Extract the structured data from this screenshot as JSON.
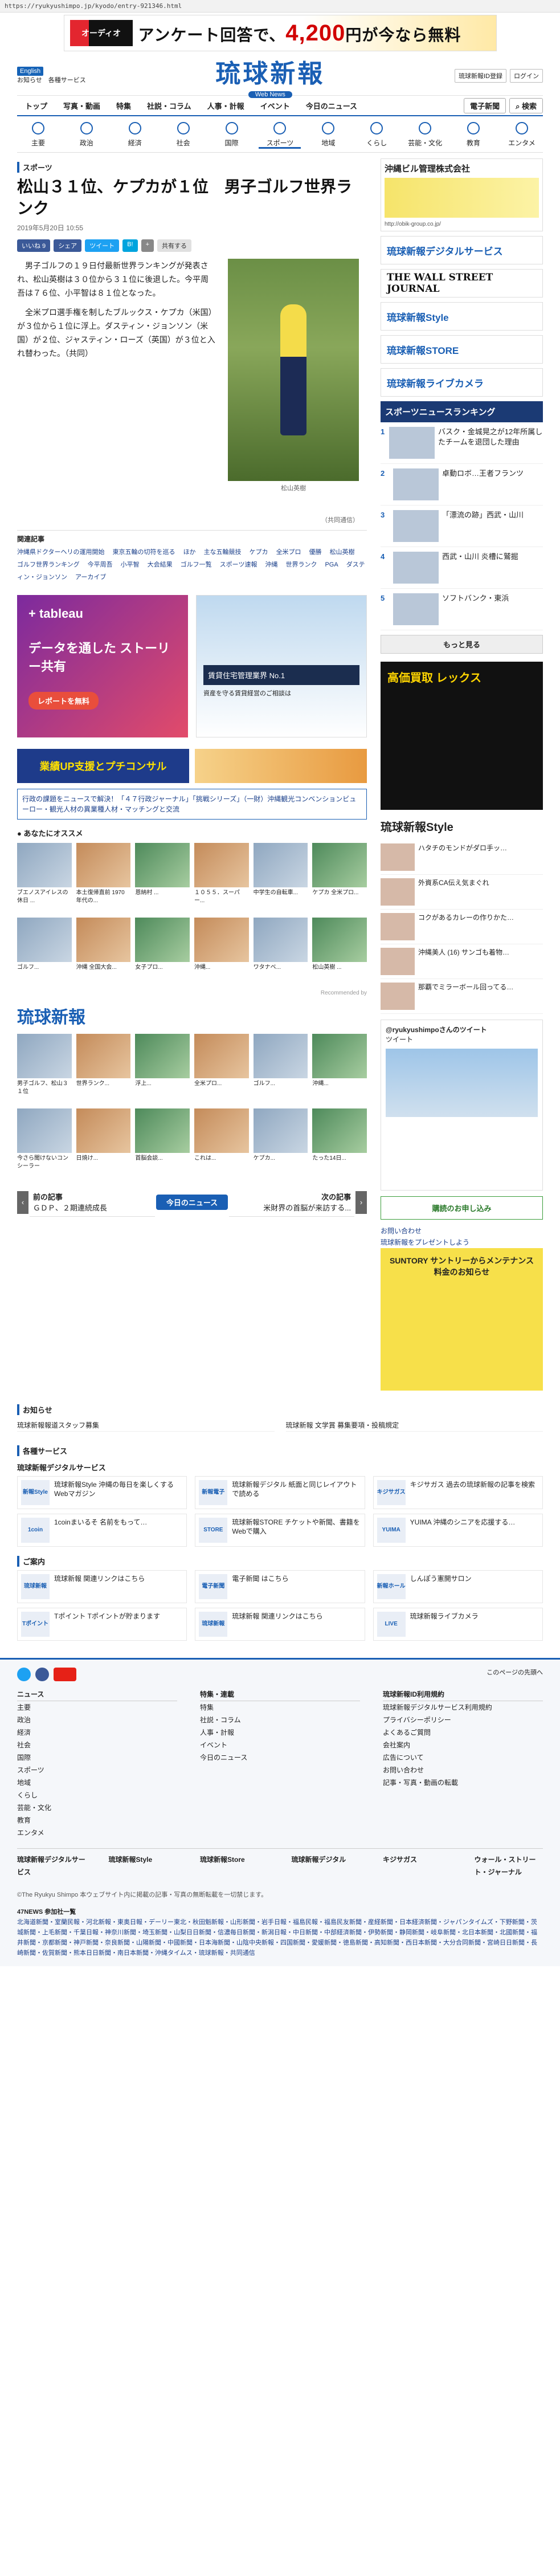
{
  "url": "https://ryukyushimpo.jp/kyodo/entry-921346.html",
  "banner": {
    "logo": "オーディオ",
    "t1": "アンケート回答で、",
    "price": "4,200",
    "t2": "円が今なら無料"
  },
  "header": {
    "en": "English",
    "info": "お知らせ",
    "svc": "各種サービス",
    "jp": "琉球新報",
    "sub": "Web News",
    "r1": "琉球新報ID登録",
    "r2": "ログイン"
  },
  "gnav": [
    "トップ",
    "写真・動画",
    "特集",
    "社説・コラム",
    "人事・計報",
    "イベント",
    "今日のニュース",
    "電子新聞",
    "検索"
  ],
  "cnav": [
    "主要",
    "政治",
    "経済",
    "社会",
    "国際",
    "スポーツ",
    "地域",
    "くらし",
    "芸能・文化",
    "教育",
    "エンタメ"
  ],
  "article": {
    "cat": "スポーツ",
    "title": "松山３１位、ケプカが１位　男子ゴルフ世界ランク",
    "date": "2019年5月20日 10:55",
    "share": [
      "いいね 9",
      "シェア",
      "ツイート",
      "B!",
      "+",
      "共有する"
    ],
    "p1": "　男子ゴルフの１９日付最新世界ランキングが発表され、松山英樹は３０位から３１位に後退した。今平周吾は７６位、小平智は８１位となった。",
    "p2": "　全米プロ選手権を制したブルックス・ケプカ（米国）が３位から１位に浮上。ダスティン・ジョンソン（米国）が２位、ジャスティン・ローズ（英国）が３位と入れ替わった。（共同）",
    "caption": "松山英樹",
    "credit": "（共同通信）"
  },
  "related": {
    "title": "関連記事",
    "links": [
      "沖縄県ドクターヘリの運用開始",
      "東京五輪の切符を巡る",
      "ほか",
      "主な五輪競技",
      "ケプカ",
      "全米プロ",
      "優勝",
      "松山英樹",
      "ゴルフ世界ランキング",
      "今平周吾",
      "小平智",
      "大会結果",
      "ゴルフ一覧",
      "スポーツ速報",
      "沖縄",
      "世界ランク",
      "PGA",
      "ダスティン・ジョンソン",
      "アーカイブ"
    ]
  },
  "ads": {
    "tab": "データを通した ストーリー共有",
    "tabbtn": "レポートを無料",
    "house": "賃貸住宅管理業界 No.1",
    "housebox": "資産を守る賃貸経営のご相談は"
  },
  "strip": {
    "a": "業績UP支援とプチコンサル"
  },
  "info": "行政の課題をニュースで解決！「４７行政ジャーナル」「挑戦シリーズ」（一財）沖縄観光コンベンションビューロー・観光人材の異業種人材・マッチングと交流",
  "rec": {
    "head": "あなたにオススメ",
    "items": [
      "ブエノスアイレスの休日 ...",
      "本土復帰直前 1970 年代の...",
      "恩納村 ...",
      "１０５５．スーパー...",
      "中学生の自転車...",
      "ケプカ 全米プロ...",
      "ゴルフ...",
      "沖縄 全国大会...",
      "女子プロ...",
      "沖縄...",
      "ワタナベ...",
      "松山英樹 ..."
    ],
    "by": "Recommended by"
  },
  "sub_logo": "琉球新報",
  "sub_items": [
    "男子ゴルフ、松山３１位",
    "世界ランク...",
    "浮上...",
    "全米プロ...",
    "ゴルフ...",
    "沖縄...",
    "今さら聞けないコンシーラー",
    "日焼け...",
    "首脳会談...",
    "これは...",
    "ケプカ...",
    "たった14日..."
  ],
  "pager": {
    "prev": "前の記事",
    "prevt": "ＧＤＰ、２期連続成長",
    "today": "今日のニュース",
    "next": "次の記事",
    "nextt": "米財界の首脳が来訪する..."
  },
  "right": {
    "ad1": "沖縄ビル管理株式会社",
    "ad2": "http://obik-group.co.jp/",
    "logo1": "琉球新報デジタルサービス",
    "logo2": "THE WALL STREET JOURNAL",
    "logo3": "琉球新報Style",
    "logo4": "琉球新報STORE",
    "logo5": "琉球新報ライブカメラ",
    "rank": "スポーツニュースランキング",
    "ranks": [
      "バスク・金城晃之が12年所属したチームを退団した理由",
      "卓動ロボ…王者フランツ",
      "「漂流の跡」西武・山川",
      "西武・山川 炎槽に鷲掘",
      "ソフトバンク・東浜"
    ],
    "more": "もっと見る",
    "buy": "高価買取 レックス",
    "style": "琉球新報Style",
    "styles": [
      "ハタチのモンドがダロ手ッ…",
      "外資系CA伝え気まぐれ",
      "コクがあるカレーの作りかた…",
      "沖縄美人 (16) サンゴも着物…",
      "那覇でミラーボール回ってる…"
    ],
    "tweets": "@ryukyushimpoさんのツイート",
    "tw_title": "ツイート",
    "subscribe": "購読のお申し込み",
    "links": [
      "お問い合わせ",
      "琉球新報をプレゼントしよう"
    ],
    "suntory": "SUNTORY サントリーからメンテナンス料金のお知らせ"
  },
  "notice": {
    "head": "お知らせ",
    "items": [
      "琉球新報報道スタッフ募集",
      "琉球新報 文学賞 募集要項・投稿規定"
    ]
  },
  "services": {
    "head": "各種サービス",
    "digital": "琉球新報デジタルサービス",
    "items": [
      [
        "新報Style",
        "琉球新報Style 沖縄の毎日を楽しくする Webマガジン"
      ],
      [
        "新報電子",
        "琉球新報デジタル 紙面と同じレイアウトで読める"
      ],
      [
        "キジサガス",
        "キジサガス 過去の琉球新報の記事を検索"
      ],
      [
        "1coin",
        "1coinまいるそ 名前をもって…"
      ],
      [
        "STORE",
        "琉球新報STORE チケットや新聞、書籍をWebで購入"
      ],
      [
        "YUIMA",
        "YUIMA 沖縄のシニアを応援する…"
      ]
    ],
    "guide": "ご案内",
    "gitems": [
      [
        "琉球新報",
        "琉球新報 関連リンクはこちら"
      ],
      [
        "電子新聞",
        "電子新聞 はこちら"
      ],
      [
        "新報ホール",
        "しんぽう憲開サロン"
      ],
      [
        "Tポイント",
        "Tポイント Tポイントが貯まります"
      ],
      [
        "琉球新報",
        "琉球新報 関連リンクはこちら"
      ],
      [
        "LIVE",
        "琉球新報ライブカメラ"
      ]
    ]
  },
  "footer": {
    "sns_follow": "このページの先頭へ",
    "cols": [
      [
        "ニュース",
        "主要",
        "政治",
        "経済",
        "社会",
        "国際",
        "スポーツ",
        "地域",
        "くらし",
        "芸能・文化",
        "教育",
        "エンタメ"
      ],
      [
        "特集・連載",
        "特集",
        "社説・コラム",
        "人事・計報",
        "イベント",
        "今日のニュース"
      ],
      [
        "琉球新報ID利用規約",
        "琉球新報デジタルサービス利用規約",
        "プライバシーポリシー",
        "よくあるご質問",
        "会社案内",
        "広告について",
        "お問い合わせ",
        "記事・写真・動画の転載"
      ]
    ],
    "bottom": [
      "琉球新報デジタルサービス",
      "琉球新報Style",
      "琉球新報Store",
      "琉球新報デジタル",
      "キジサガス",
      "ウォール・ストリート・ジャーナル"
    ],
    "copy": "©The Ryukyu Shimpo 本ウェブサイト内に掲載の記事・写真の無断転載を一切禁じます。",
    "f47": "47NEWS 参加社一覧",
    "f47list": "北海道新聞・室蘭民報・河北新報・東奥日報・デーリー東北・秋田魁新報・山形新聞・岩手日報・福島民報・福島民友新聞・産経新聞・日本経済新聞・ジャパンタイムズ・下野新聞・茨城新聞・上毛新聞・千葉日報・神奈川新聞・埼玉新聞・山梨日日新聞・信濃毎日新聞・新潟日報・中日新聞・中部経済新聞・伊勢新聞・静岡新聞・岐阜新聞・北日本新聞・北國新聞・福井新聞・京都新聞・神戸新聞・奈良新聞・山陽新聞・中國新聞・日本海新聞・山陰中央新報・四国新聞・愛媛新聞・徳島新聞・高知新聞・西日本新聞・大分合同新聞・宮崎日日新聞・長崎新聞・佐賀新聞・熊本日日新聞・南日本新聞・沖縄タイムス・琉球新報・共同通信"
  }
}
